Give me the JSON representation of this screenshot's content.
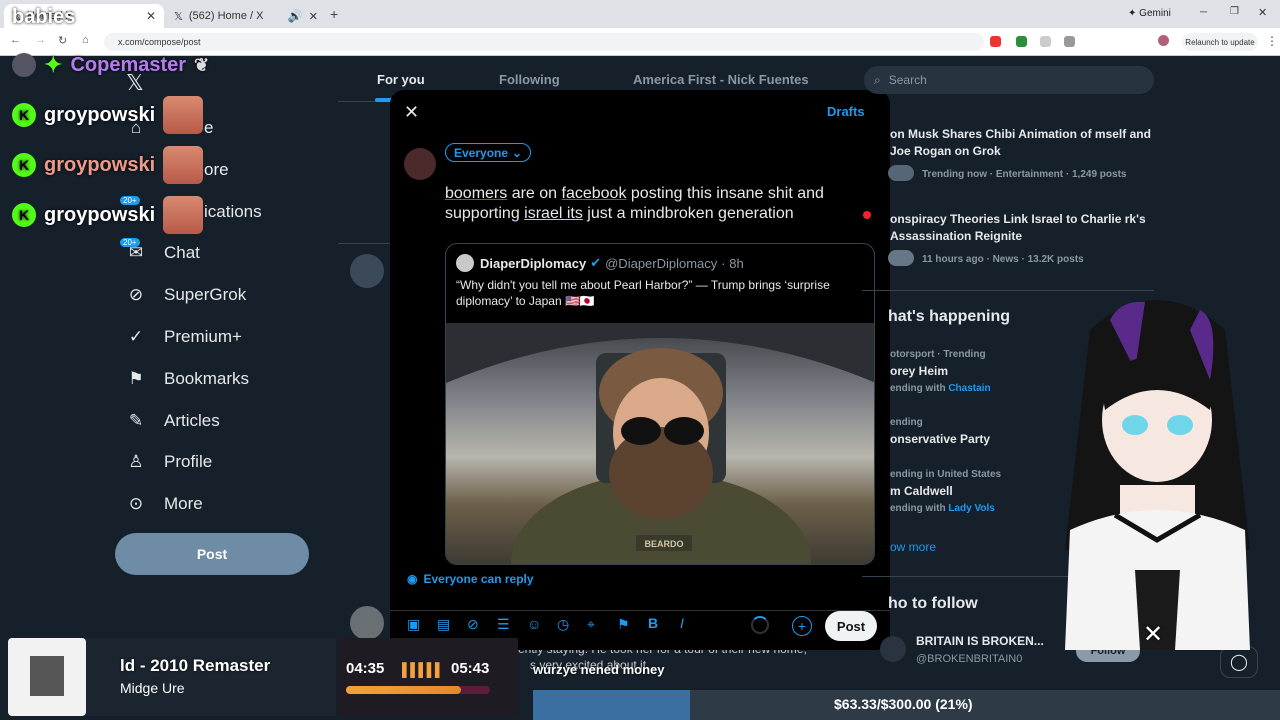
{
  "browser": {
    "tabs": [
      {
        "label": "Home / X"
      },
      {
        "label": "(562) Home / X"
      }
    ],
    "url": "x.com/compose/post",
    "gemini_label": "Gemini",
    "relaunch_label": "Relaunch to update"
  },
  "stream_overlay": {
    "corner_text": "babies",
    "chat": [
      {
        "user": "Copemaster",
        "color": "#b57cf2"
      },
      {
        "user": "groypowski",
        "color": "#ffffff"
      },
      {
        "user": "groypowski",
        "color": "#f09a8a"
      },
      {
        "user": "groypowski",
        "color": "#ffffff"
      }
    ],
    "badge_20": "20+"
  },
  "sidebar": {
    "items": [
      {
        "label": "Home",
        "visible": "e",
        "icon": "home-icon"
      },
      {
        "label": "Explore",
        "visible": "ore",
        "icon": "search-icon"
      },
      {
        "label": "Notifications",
        "visible": "ications",
        "icon": "bell-icon"
      },
      {
        "label": "Chat",
        "icon": "mail-icon"
      },
      {
        "label": "SuperGrok",
        "icon": "grok-icon"
      },
      {
        "label": "Premium+",
        "icon": "verified-icon"
      },
      {
        "label": "Bookmarks",
        "icon": "bookmark-icon"
      },
      {
        "label": "Articles",
        "icon": "article-icon"
      },
      {
        "label": "Profile",
        "icon": "person-icon"
      },
      {
        "label": "More",
        "icon": "more-icon"
      }
    ],
    "post_button": "Post"
  },
  "timeline": {
    "tabs": [
      "For you",
      "Following",
      "America First - Nick Fuentes"
    ],
    "background_snippets": [
      "ently staying. He took her for a tour of their new home,",
      "s very excited about it"
    ]
  },
  "compose_modal": {
    "drafts_label": "Drafts",
    "audience": "Everyone",
    "text_parts": [
      "boomers",
      " are on ",
      "facebook",
      " posting this insane shit and supporting ",
      "israel its",
      " just a mindbroken generation"
    ],
    "quote": {
      "name": "DiaperDiplomacy",
      "handle": "@DiaperDiplomacy",
      "time": "· 8h",
      "text": "“Why didn't you tell me about Pearl Harbor?” — Trump brings ‘surprise diplomacy’ to Japan 🇺🇸🇯🇵",
      "image_patch": "BEARDO"
    },
    "reply_setting": "Everyone can reply",
    "post_button": "Post"
  },
  "right_column": {
    "search_placeholder": "Search",
    "news": [
      {
        "title": "on Musk Shares Chibi Animation of mself and Joe Rogan on Grok",
        "meta": "Trending now · Entertainment · 1,249 posts"
      },
      {
        "title": "onspiracy Theories Link Israel to Charlie rk's Assassination Reignite",
        "meta": "11 hours ago · News · 13.2K posts"
      }
    ],
    "happening_header": "hat's happening",
    "trends": [
      {
        "context": "otorsport · Trending",
        "name": "orey Heim",
        "with_prefix": "ending with ",
        "with": "Chastain"
      },
      {
        "context": "ending",
        "name": "onservative Party",
        "with_prefix": "",
        "with": ""
      },
      {
        "context": "ending in United States",
        "name": "m Caldwell",
        "with_prefix": "ending with ",
        "with": "Lady Vols"
      }
    ],
    "show_more": "ow more",
    "who_to_follow_header": "ho to follow",
    "follow": {
      "name": "BRITAIN IS BROKEN...",
      "handle": "@BROKENBRITAIN0",
      "button": "Follow"
    }
  },
  "music_widget": {
    "title": "ld - 2010 Remaster",
    "artist": "Midge Ure",
    "elapsed": "04:35",
    "total": "05:43",
    "progress": 0.8
  },
  "donation_goal": {
    "ticker": "wurzye nened money",
    "text": "$63.33/$300.00 (21%)",
    "fraction": 0.21
  }
}
